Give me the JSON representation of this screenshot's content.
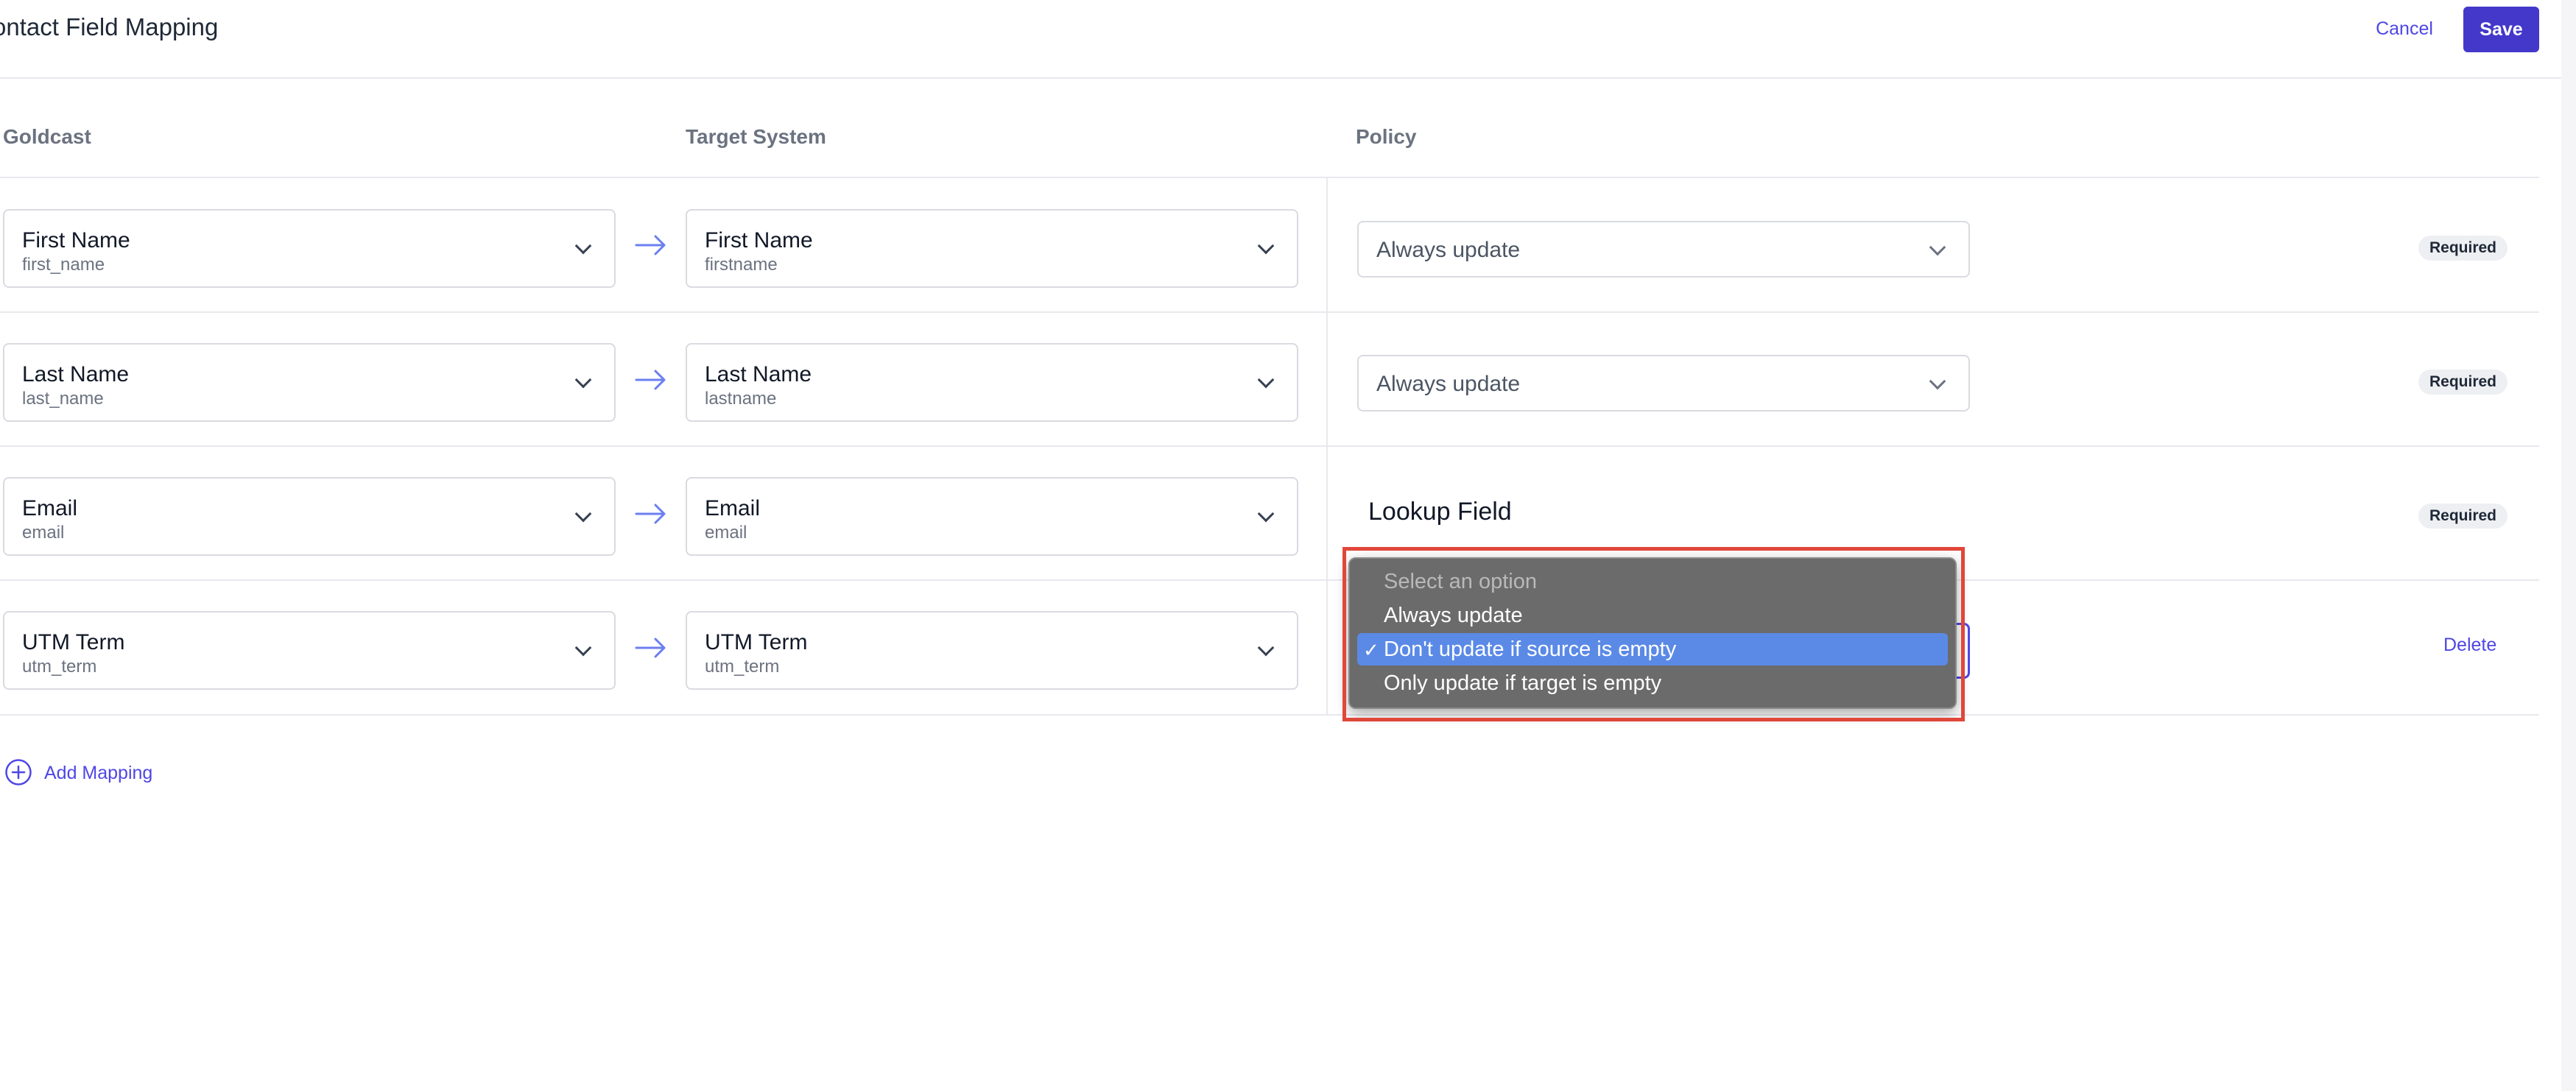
{
  "header": {
    "title": "ontact Field Mapping",
    "cancel_label": "Cancel",
    "save_label": "Save"
  },
  "columns": {
    "source": "Goldcast",
    "target": "Target System",
    "policy": "Policy"
  },
  "rows": [
    {
      "source_label": "First Name",
      "source_key": "first_name",
      "target_label": "First Name",
      "target_key": "firstname",
      "policy": "Always update",
      "badge": "Required"
    },
    {
      "source_label": "Last Name",
      "source_key": "last_name",
      "target_label": "Last Name",
      "target_key": "lastname",
      "policy": "Always update",
      "badge": "Required"
    },
    {
      "source_label": "Email",
      "source_key": "email",
      "target_label": "Email",
      "target_key": "email",
      "policy": "Lookup Field",
      "badge": "Required"
    },
    {
      "source_label": "UTM Term",
      "source_key": "utm_term",
      "target_label": "UTM Term",
      "target_key": "utm_term",
      "action": "Delete"
    }
  ],
  "dropdown": {
    "options": [
      "Select an option",
      "Always update",
      "Don't update if source is empty",
      "Only update if target is empty"
    ],
    "selected_index": 2,
    "check": "✓"
  },
  "add_mapping_label": "Add Mapping",
  "colors": {
    "accent": "#4f46e5",
    "primary_button": "#4338ca",
    "highlight": "#e0473a",
    "menu_bg": "#6b6b6b",
    "menu_selected": "#5b8ae6"
  }
}
